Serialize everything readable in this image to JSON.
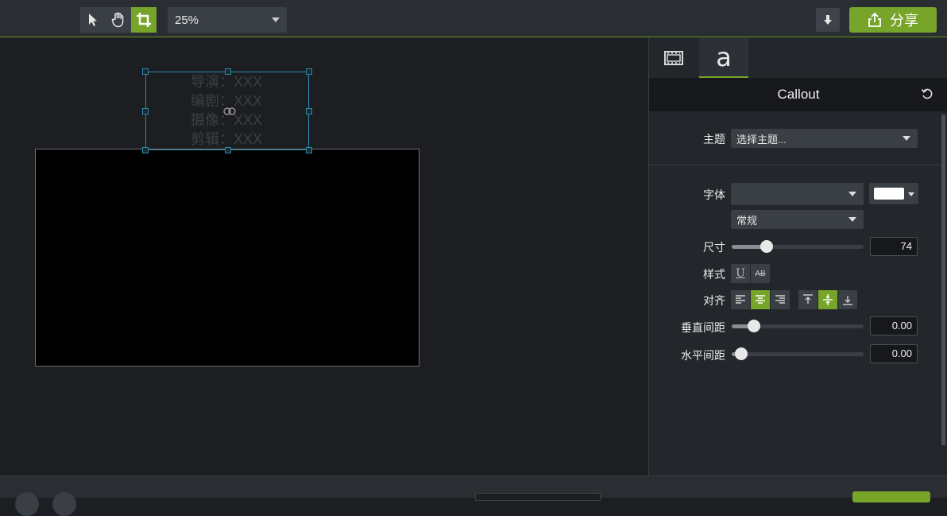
{
  "toolbar": {
    "tools": [
      {
        "name": "select-tool",
        "icon": "arrow-pointer-icon",
        "active": false
      },
      {
        "name": "pan-tool",
        "icon": "hand-icon",
        "active": false
      },
      {
        "name": "crop-tool",
        "icon": "crop-icon",
        "active": true
      }
    ],
    "zoom_value": "25%",
    "download_icon": "arrow-down-icon",
    "share_label": "分享",
    "share_icon": "share-upload-icon"
  },
  "canvas": {
    "callout_lines": [
      "导演：XXX",
      "编剧：XXX",
      "摄像：XXX",
      "剪辑：XXX"
    ]
  },
  "panel": {
    "tabs": [
      {
        "name": "media-tab",
        "icon": "film-strip-icon"
      },
      {
        "name": "text-tab",
        "label": "a",
        "active": true
      }
    ],
    "title": "Callout",
    "reset_icon": "reset-icon",
    "theme_label": "主题",
    "theme_value": "选择主题...",
    "font_label": "字体",
    "font_value": "",
    "font_color": "#ffffff",
    "font_weight_value": "常规",
    "size_label": "尺寸",
    "size_value": "74",
    "style_label": "样式",
    "style_buttons": [
      "U",
      "AB"
    ],
    "align_label": "对齐",
    "vspacing_label": "垂直间距",
    "vspacing_value": "0.00",
    "hspacing_label": "水平间距",
    "hspacing_value": "0.00"
  },
  "colors": {
    "accent": "#77a52a",
    "background": "#1c1e22",
    "panel": "#23262b",
    "selection": "#2a8aa8"
  }
}
